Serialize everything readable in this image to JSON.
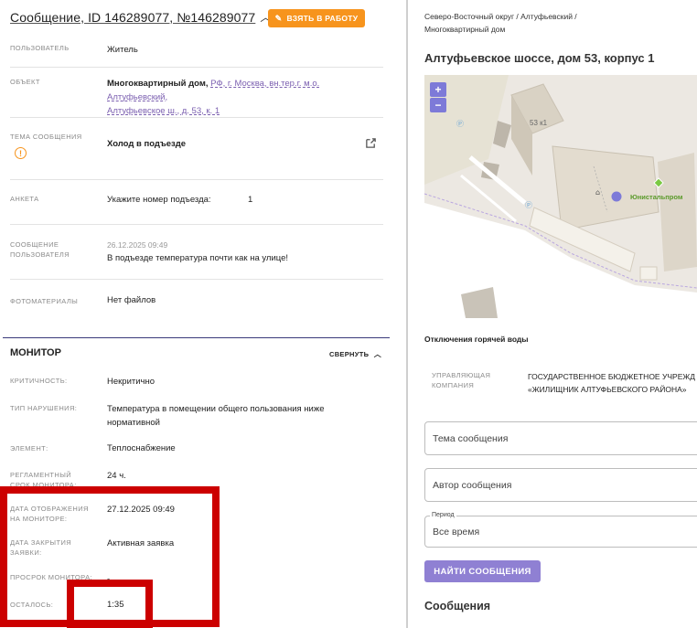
{
  "header": {
    "title": "Сообщение, ID 146289077, №146289077",
    "take_button": "ВЗЯТЬ В РАБОТУ"
  },
  "fields": {
    "user_label": "ПОЛЬЗОВАТЕЛЬ",
    "user_value": "Житель",
    "object_label": "ОБЪЕКТ",
    "object_value_bold": "Многоквартирный дом,",
    "object_value_link1": "РФ, г. Москва, вн.тер.г. м.о. Алтуфьевский,",
    "object_value_link2": "Алтуфьевское ш., д. 53, к. 1",
    "topic_label": "ТЕМА СООБЩЕНИЯ",
    "topic_value": "Холод в подъезде",
    "form_label": "АНКЕТА",
    "form_question": "Укажите номер подъезда:",
    "form_answer": "1",
    "message_label_1": "СООБЩЕНИЕ",
    "message_label_2": "ПОЛЬЗОВАТЕЛЯ",
    "message_date": "26.12.2025 09:49",
    "message_text": "В подъезде температура почти как на улице!",
    "photos_label": "ФОТОМАТЕРИАЛЫ",
    "photos_value": "Нет файлов"
  },
  "monitor": {
    "title": "МОНИТОР",
    "collapse": "СВЕРНУТЬ",
    "criticality_label": "КРИТИЧНОСТЬ:",
    "criticality_value": "Некритично",
    "violation_label": "ТИП НАРУШЕНИЯ:",
    "violation_value_1": "Температура в помещении общего пользования ниже",
    "violation_value_2": "нормативной",
    "element_label": "ЭЛЕМЕНТ:",
    "element_value": "Теплоснабжение",
    "term_label_1": "РЕГЛАМЕНТНЫЙ",
    "term_label_2": "СРОК МОНИТОРА:",
    "term_value": "24 ч.",
    "display_label_1": "ДАТА ОТОБРАЖЕНИЯ",
    "display_label_2": "НА МОНИТОРЕ:",
    "display_value": "27.12.2025 09:49",
    "close_label_1": "ДАТА ЗАКРЫТИЯ",
    "close_label_2": "ЗАЯВКИ:",
    "close_value": "Активная заявка",
    "overdue_label": "ПРОСРОК МОНИТОРА:",
    "overdue_value": "-",
    "left_label": "ОСТАЛОСЬ:",
    "left_value": "1:35"
  },
  "right": {
    "breadcrumb_1": "Северо-Восточный округ / Алтуфьевский /",
    "breadcrumb_2": "Многоквартирный дом",
    "address": "Алтуфьевское шоссе, дом 53, корпус 1",
    "map_building_label": "53 к1",
    "map_poi_label": "Юнистальпром",
    "zoom_in": "+",
    "zoom_out": "−",
    "hot_water": "Отключения горячей воды",
    "uk_label_1": "УПРАВЛЯЮЩАЯ",
    "uk_label_2": "КОМПАНИЯ",
    "uk_value_1": "ГОСУДАРСТВЕННОЕ БЮДЖЕТНОЕ УЧРЕЖД",
    "uk_value_2": "«ЖИЛИЩНИК АЛТУФЬЕВСКОГО РАЙОНА»",
    "topic_placeholder": "Тема сообщения",
    "author_placeholder": "Автор сообщения",
    "period_label": "Период",
    "period_value": "Все время",
    "search_button": "НАЙТИ СООБЩЕНИЯ",
    "messages_title": "Сообщения"
  },
  "colors": {
    "accent_orange": "#f7941d",
    "accent_purple": "#8f80d3",
    "highlight_red": "#cc0000"
  }
}
